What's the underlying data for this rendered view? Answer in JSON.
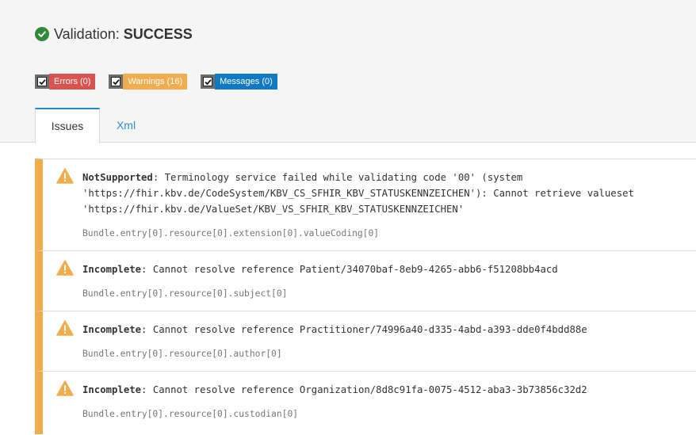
{
  "validation": {
    "label": "Validation:",
    "status": "SUCCESS",
    "status_icon": "check-circle-icon",
    "status_color": "#2e8b3a"
  },
  "filters": [
    {
      "name": "errors-filter",
      "label": "Errors (0)",
      "color": "#d9534f",
      "checked": true
    },
    {
      "name": "warnings-filter",
      "label": "Warnings (16)",
      "color": "#f0ad4e",
      "checked": true
    },
    {
      "name": "messages-filter",
      "label": "Messages (0)",
      "color": "#0f7ac3",
      "checked": true
    }
  ],
  "tabs": [
    {
      "label": "Issues",
      "active": true
    },
    {
      "label": "Xml",
      "active": false
    }
  ],
  "issues": [
    {
      "severity_icon": "warning-icon",
      "type": "NotSupported",
      "message": ": Terminology service failed while validating code '00' (system 'https://fhir.kbv.de/CodeSystem/KBV_CS_SFHIR_KBV_STATUSKENNZEICHEN'): Cannot retrieve valueset 'https://fhir.kbv.de/ValueSet/KBV_VS_SFHIR_KBV_STATUSKENNZEICHEN'",
      "path": "Bundle.entry[0].resource[0].extension[0].valueCoding[0]"
    },
    {
      "severity_icon": "warning-icon",
      "type": "Incomplete",
      "message": ": Cannot resolve reference Patient/34070baf-8eb9-4265-abb6-f51208bb4acd",
      "path": "Bundle.entry[0].resource[0].subject[0]"
    },
    {
      "severity_icon": "warning-icon",
      "type": "Incomplete",
      "message": ": Cannot resolve reference Practitioner/74996a40-d335-4abd-a393-dde0f4bdd88e",
      "path": "Bundle.entry[0].resource[0].author[0]"
    },
    {
      "severity_icon": "warning-icon",
      "type": "Incomplete",
      "message": ": Cannot resolve reference Organization/8d8c91fa-0075-4512-aba3-3b73856c32d2",
      "path": "Bundle.entry[0].resource[0].custodian[0]"
    }
  ]
}
